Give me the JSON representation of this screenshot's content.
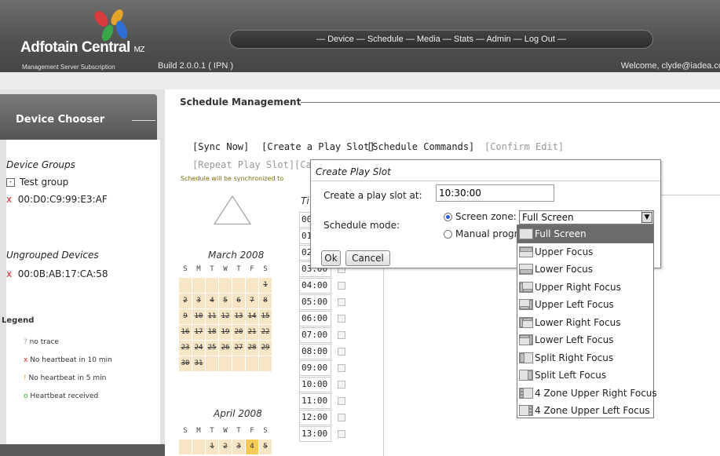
{
  "header": {
    "logo_text": "Adfotain Central",
    "logo_mz": "MZ",
    "logo_subtitle": "Management Server Subscription",
    "build": "Build 2.0.0.1 ( IPN )",
    "nav": "— Device — Schedule — Media — Stats — Admin — Log Out —",
    "welcome": "Welcome, clyde@iadea.co"
  },
  "sidebar": {
    "title": "Device Chooser",
    "device_groups_label": "Device Groups",
    "group_toggle": "-",
    "group_name": "Test group",
    "group_device_mark": "x",
    "group_device": "00:D0:C9:99:E3:AF",
    "ungrouped_label": "Ungrouped Devices",
    "ungrouped_mark": "x",
    "ungrouped_device": "00:0B:AB:17:CA:58",
    "legend_title": "Legend",
    "legend": [
      {
        "mark": "?",
        "text": "no trace"
      },
      {
        "mark": "x",
        "text": "No heartbeat in 10 min"
      },
      {
        "mark": "!",
        "text": "No heartbeat in 5 min"
      },
      {
        "mark": "o",
        "text": "Heartbeat received"
      }
    ]
  },
  "main": {
    "title": "Schedule Management",
    "sync_now": "[Sync Now]",
    "create_play_slot": "[Create a Play Slot]",
    "schedule_commands": "[Schedule Commands]",
    "confirm_edit": "[Confirm Edit]",
    "repeat_play_slot": "[Repeat Play Slot]",
    "partial_link": "[Ca",
    "sync_note": "Schedule will be synchronized to",
    "time_header": "Ti",
    "times": [
      "00",
      "01",
      "02",
      "03:00",
      "04:00",
      "05:00",
      "06:00",
      "07:00",
      "08:00",
      "09:00",
      "10:00",
      "11:00",
      "12:00",
      "13:00"
    ],
    "calendars": [
      {
        "title": "March 2008",
        "weekdays": [
          "S",
          "M",
          "T",
          "W",
          "T",
          "F",
          "S"
        ],
        "days": [
          [
            "",
            "",
            "",
            "",
            "",
            "",
            "1"
          ],
          [
            "2",
            "3",
            "4",
            "5",
            "6",
            "7",
            "8"
          ],
          [
            "9",
            "10",
            "11",
            "12",
            "13",
            "14",
            "15"
          ],
          [
            "16",
            "17",
            "18",
            "19",
            "20",
            "21",
            "22"
          ],
          [
            "23",
            "24",
            "25",
            "26",
            "27",
            "28",
            "29"
          ],
          [
            "30",
            "31",
            "",
            "",
            "",
            "",
            ""
          ]
        ]
      },
      {
        "title": "April 2008",
        "weekdays": [
          "S",
          "M",
          "T",
          "W",
          "T",
          "F",
          "S"
        ],
        "days": [
          [
            "",
            "",
            "1",
            "2",
            "3",
            "4",
            "5"
          ]
        ],
        "today": "4"
      }
    ]
  },
  "dialog": {
    "title": "Create Play Slot",
    "create_at_label": "Create a play slot at:",
    "create_at_value": "10:30:00",
    "mode_label": "Schedule mode:",
    "screen_zone_label": "Screen zone:",
    "screen_zone_value": "Full Screen",
    "manual_label": "Manual progra",
    "ok": "Ok",
    "cancel": "Cancel"
  },
  "dropdown": {
    "selected_index": 0,
    "options": [
      {
        "label": "Full Screen",
        "icon": "zone-full-icon"
      },
      {
        "label": "Upper Focus",
        "icon": "zone-upper-icon"
      },
      {
        "label": "Lower Focus",
        "icon": "zone-lower-icon"
      },
      {
        "label": "Upper Right Focus",
        "icon": "zone-upper-right-icon"
      },
      {
        "label": "Upper Left Focus",
        "icon": "zone-upper-left-icon"
      },
      {
        "label": "Lower Right Focus",
        "icon": "zone-lower-right-icon"
      },
      {
        "label": "Lower Left Focus",
        "icon": "zone-lower-left-icon"
      },
      {
        "label": "Split Right Focus",
        "icon": "zone-split-right-icon"
      },
      {
        "label": "Split Left Focus",
        "icon": "zone-split-left-icon"
      },
      {
        "label": "4 Zone Upper Right Focus",
        "icon": "zone-4-upper-right-icon"
      },
      {
        "label": "4 Zone Upper Left Focus",
        "icon": "zone-4-upper-left-icon"
      }
    ]
  },
  "colors": {
    "header": "#505050",
    "accent_red": "#dd2222",
    "calendar_day": "#f7e6c6",
    "calendar_today": "#f5c95a"
  }
}
